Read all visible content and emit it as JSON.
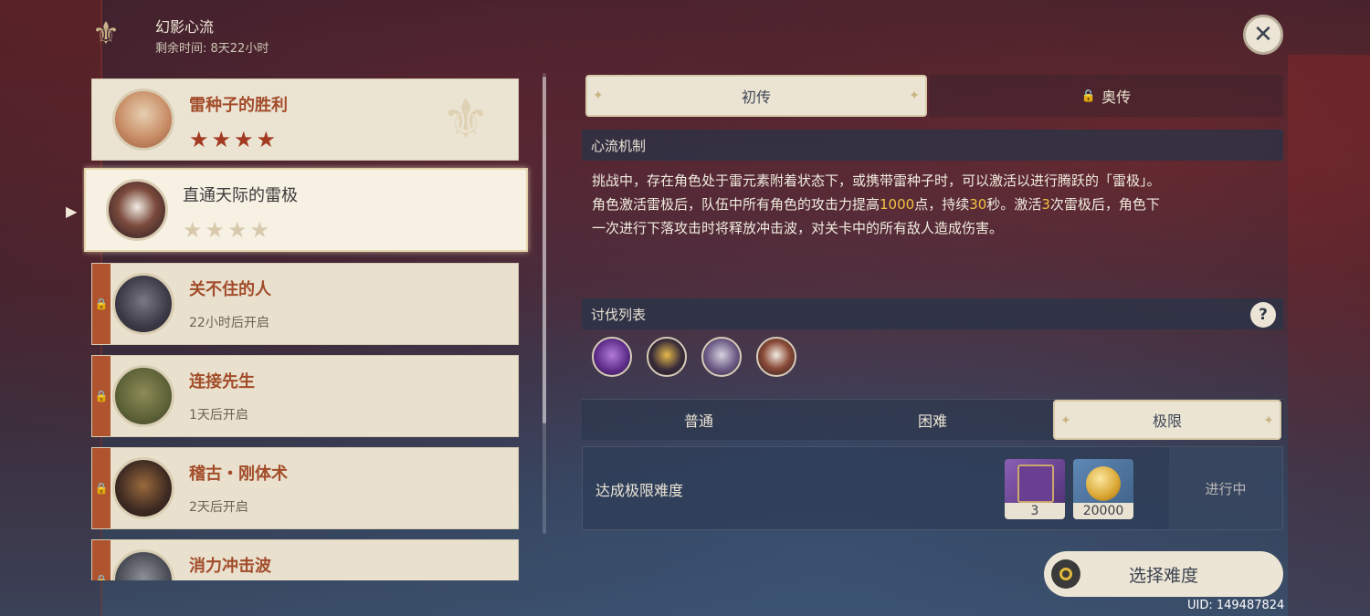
{
  "header": {
    "event_title": "幻影心流",
    "remaining_time": "剩余时间: 8天22小时"
  },
  "challenges": [
    {
      "title": "雷种子的胜利",
      "stars": "★★★★",
      "state": "completed"
    },
    {
      "title": "直通天际的雷极",
      "stars": "★★★★",
      "state": "selected"
    },
    {
      "title": "关不住的人",
      "subtitle": "22小时后开启",
      "state": "locked"
    },
    {
      "title": "连接先生",
      "subtitle": "1天后开启",
      "state": "locked"
    },
    {
      "title": "稽古・刚体术",
      "subtitle": "2天后开启",
      "state": "locked"
    },
    {
      "title": "消力冲击波",
      "state": "locked"
    }
  ],
  "tabs": {
    "first": "初传",
    "second": "奥传"
  },
  "mechanism": {
    "heading": "心流机制",
    "line1": "挑战中，存在角色处于雷元素附着状态下，或携带雷种子时，可以激活以进行腾跃的「雷极」。",
    "line2_a": "角色激活雷极后，队伍中所有角色的攻击力提高",
    "line2_n1": "1000",
    "line2_b": "点，持续",
    "line2_n2": "30",
    "line2_c": "秒。激活",
    "line2_n3": "3",
    "line2_d": "次雷极后，角色下",
    "line3": "一次进行下落攻击时将释放冲击波，对关卡中的所有敌人造成伤害。"
  },
  "enemy_list": {
    "heading": "讨伐列表",
    "help": "?"
  },
  "difficulty": {
    "normal": "普通",
    "hard": "困难",
    "extreme": "极限"
  },
  "goal": {
    "label": "达成极限难度",
    "reward1_qty": "3",
    "reward2_qty": "20000",
    "status": "进行中"
  },
  "start_button": "选择难度",
  "uid": "UID: 149487824",
  "colors": {
    "accent_red": "#a24c2a",
    "lock_bar": "#b0532f",
    "highlight": "#f2c242",
    "panel": "#ece4d3"
  }
}
